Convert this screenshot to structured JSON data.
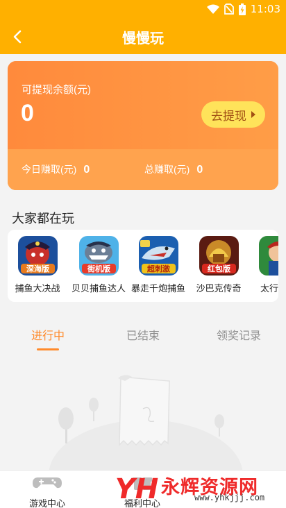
{
  "status_bar": {
    "time": "11:03",
    "icons": [
      "wifi-icon",
      "no-sim-icon",
      "battery-charging-icon"
    ]
  },
  "header": {
    "title": "慢慢玩",
    "back_icon": "chevron-left-icon"
  },
  "balance_card": {
    "label": "可提现余额(元)",
    "value": "0",
    "withdraw_label": "去提现",
    "today_label": "今日赚取(元)",
    "today_value": "0",
    "total_label": "总赚取(元)",
    "total_value": "0"
  },
  "section_title": "大家都在玩",
  "games": [
    {
      "name": "捕鱼大决战",
      "badge": "深海版",
      "icon": "pirate-fishing-game-icon"
    },
    {
      "name": "贝贝捕鱼达人",
      "badge": "街机版",
      "icon": "shark-arcade-game-icon"
    },
    {
      "name": "暴走千炮捕鱼",
      "badge": "超刺激",
      "icon": "shark-thrill-game-icon"
    },
    {
      "name": "沙巴克传奇",
      "badge": "红包版",
      "icon": "dragon-treasure-game-icon"
    },
    {
      "name": "太行三国",
      "badge": "",
      "icon": "warrior-game-icon"
    }
  ],
  "tabs": [
    {
      "label": "进行中",
      "active": true
    },
    {
      "label": "已结束",
      "active": false
    },
    {
      "label": "领奖记录",
      "active": false
    }
  ],
  "bottom_nav": [
    {
      "label": "游戏中心",
      "icon": "gamepad-icon"
    },
    {
      "label": "福利中心",
      "icon": "gift-icon"
    }
  ],
  "watermark": {
    "text": "永辉资源网",
    "url": "www.yhkjjj.com",
    "logo": "YH"
  },
  "colors": {
    "brand": "#ffb000",
    "card": "#ff8a3c",
    "accent": "#ff8a2b",
    "button": "#ffe35a"
  }
}
